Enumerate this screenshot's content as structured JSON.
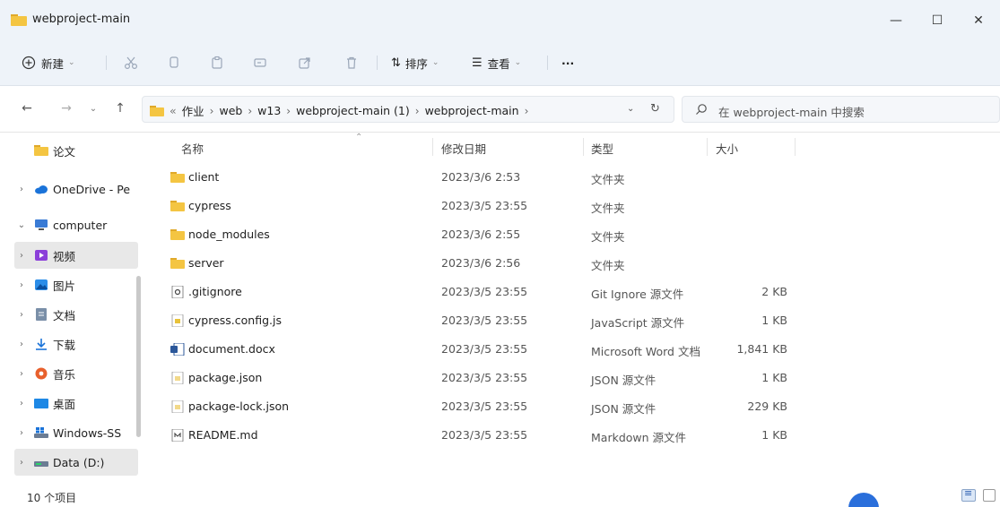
{
  "window": {
    "title": "webproject-main",
    "minimize_glyph": "—",
    "maximize_glyph": "☐",
    "close_glyph": "✕"
  },
  "toolbar": {
    "new_label": "新建",
    "sort_label": "排序",
    "view_label": "查看",
    "more_label": "···"
  },
  "address": {
    "crumbs": [
      "作业",
      "web",
      "w13",
      "webproject-main (1)",
      "webproject-main"
    ],
    "overflow": "«",
    "search_placeholder": "在 webproject-main 中搜索"
  },
  "sidebar": {
    "items": [
      {
        "label": "论文",
        "icon": "folder-icon"
      },
      {
        "label": "OneDrive - Pe",
        "icon": "cloud-icon"
      },
      {
        "label": "computer",
        "icon": "computer-icon"
      },
      {
        "label": "视频",
        "icon": "video-icon"
      },
      {
        "label": "图片",
        "icon": "pictures-icon"
      },
      {
        "label": "文档",
        "icon": "documents-icon"
      },
      {
        "label": "下载",
        "icon": "download-icon"
      },
      {
        "label": "音乐",
        "icon": "music-icon"
      },
      {
        "label": "桌面",
        "icon": "desktop-icon"
      },
      {
        "label": "Windows-SS",
        "icon": "windows-drive-icon"
      },
      {
        "label": "Data (D:)",
        "icon": "drive-icon"
      }
    ]
  },
  "columns": {
    "name": "名称",
    "modified": "修改日期",
    "type": "类型",
    "size": "大小"
  },
  "files": [
    {
      "name": "client",
      "date": "2023/3/6 2:53",
      "type": "文件夹",
      "size": "",
      "icon": "folder-icon"
    },
    {
      "name": "cypress",
      "date": "2023/3/5 23:55",
      "type": "文件夹",
      "size": "",
      "icon": "folder-icon"
    },
    {
      "name": "node_modules",
      "date": "2023/3/6 2:55",
      "type": "文件夹",
      "size": "",
      "icon": "folder-icon"
    },
    {
      "name": "server",
      "date": "2023/3/6 2:56",
      "type": "文件夹",
      "size": "",
      "icon": "folder-icon"
    },
    {
      "name": ".gitignore",
      "date": "2023/3/5 23:55",
      "type": "Git Ignore 源文件",
      "size": "2 KB",
      "icon": "gitignore-file-icon"
    },
    {
      "name": "cypress.config.js",
      "date": "2023/3/5 23:55",
      "type": "JavaScript 源文件",
      "size": "1 KB",
      "icon": "js-file-icon"
    },
    {
      "name": "document.docx",
      "date": "2023/3/5 23:55",
      "type": "Microsoft Word 文档",
      "size": "1,841 KB",
      "icon": "word-file-icon"
    },
    {
      "name": "package.json",
      "date": "2023/3/5 23:55",
      "type": "JSON 源文件",
      "size": "1 KB",
      "icon": "json-file-icon"
    },
    {
      "name": "package-lock.json",
      "date": "2023/3/5 23:55",
      "type": "JSON 源文件",
      "size": "229 KB",
      "icon": "json-file-icon"
    },
    {
      "name": "README.md",
      "date": "2023/3/5 23:55",
      "type": "Markdown 源文件",
      "size": "1 KB",
      "icon": "markdown-file-icon"
    }
  ],
  "status": {
    "item_count": "10 个项目"
  },
  "colors": {
    "folder": "#f4c542",
    "chrome_bg": "#eef3f9",
    "selection": "#e8e8e8"
  }
}
